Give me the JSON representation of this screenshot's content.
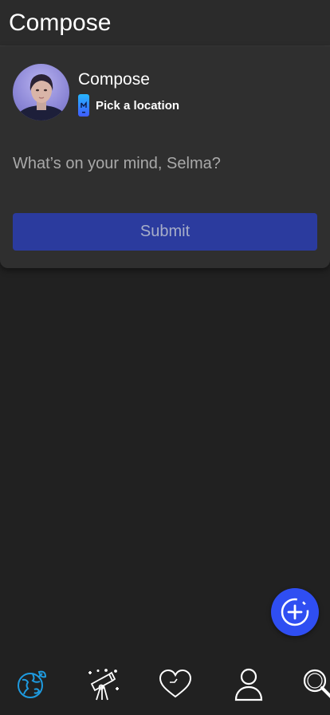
{
  "header": {
    "title": "Compose"
  },
  "compose": {
    "title": "Compose",
    "location_label": "Pick a location",
    "placeholder": "What’s on your mind, Selma?",
    "submit_label": "Submit"
  },
  "fab": {
    "icon": "add-circle-icon"
  },
  "bottom_nav": [
    {
      "icon": "globe-icon",
      "active": true
    },
    {
      "icon": "telescope-icon",
      "active": false
    },
    {
      "icon": "heart-icon",
      "active": false
    },
    {
      "icon": "person-icon",
      "active": false
    },
    {
      "icon": "search-icon",
      "active": false
    }
  ],
  "colors": {
    "accent": "#2f4ef2",
    "submit_bg": "#2b3b9e",
    "active_nav": "#1e9be0",
    "background": "#212121"
  }
}
